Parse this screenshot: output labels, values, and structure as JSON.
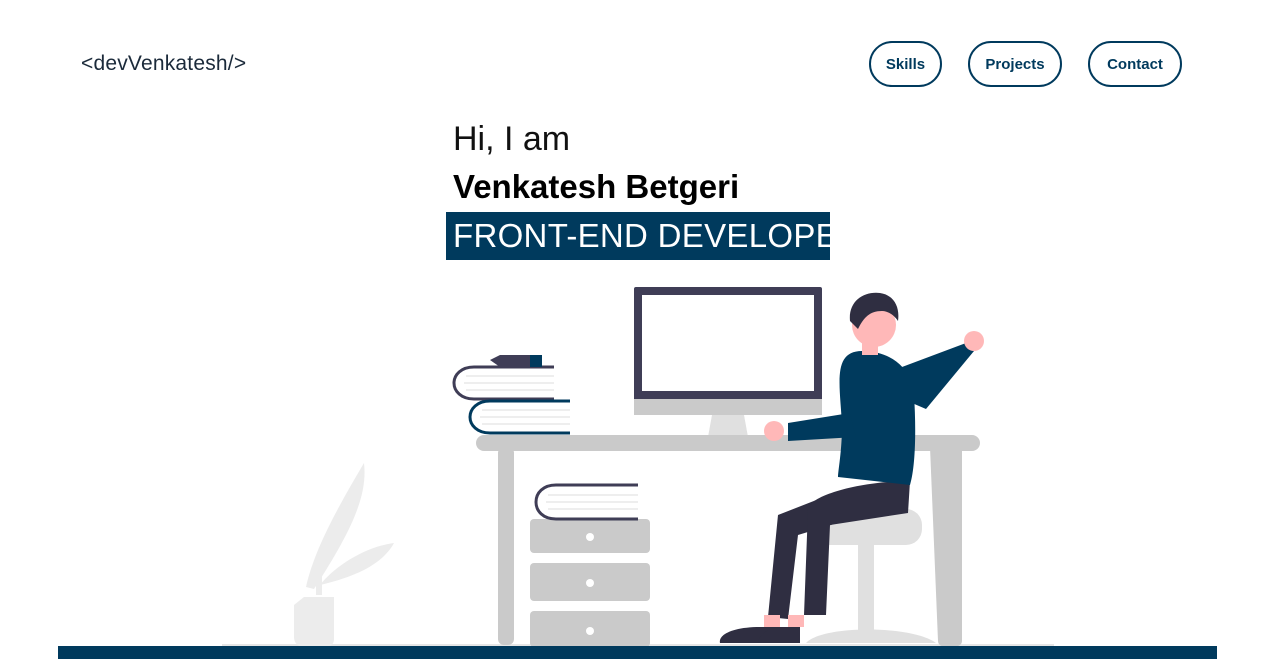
{
  "header": {
    "logo": "<devVenkatesh/>",
    "nav": [
      {
        "label": "Skills"
      },
      {
        "label": "Projects"
      },
      {
        "label": "Contact"
      }
    ]
  },
  "hero": {
    "greeting": "Hi, I am",
    "name": "Venkatesh Betgeri",
    "role": "FRONT-END DEVELOPER"
  },
  "colors": {
    "accent": "#003a5d",
    "figure_dark": "#2f2e41",
    "skin": "#ffb8b8",
    "desk": "#cacaca"
  },
  "illustration": {
    "name": "developer-at-desk-illustration"
  }
}
